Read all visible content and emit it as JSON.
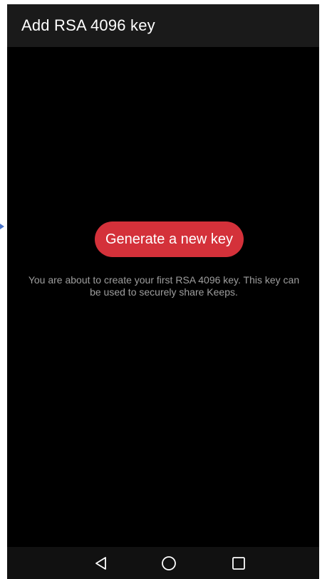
{
  "app_bar": {
    "title": "Add RSA 4096 key"
  },
  "main": {
    "generate_button_label": "Generate a new key",
    "info_text": "You are about to create your first RSA 4096 key. This key can be used to securely share Keeps."
  },
  "navigation_bar": {
    "icons": [
      "back-triangle-icon",
      "home-circle-icon",
      "recents-square-icon"
    ]
  },
  "colors": {
    "screen_background": "#000000",
    "app_bar_background": "#1a1a1a",
    "button_background": "#d4313a",
    "button_text": "#ffffff",
    "info_text": "#9e9e9e",
    "nav_bar_background": "#111111",
    "nav_icon": "#ffffff",
    "edge_arrow": "#4a74c9"
  }
}
